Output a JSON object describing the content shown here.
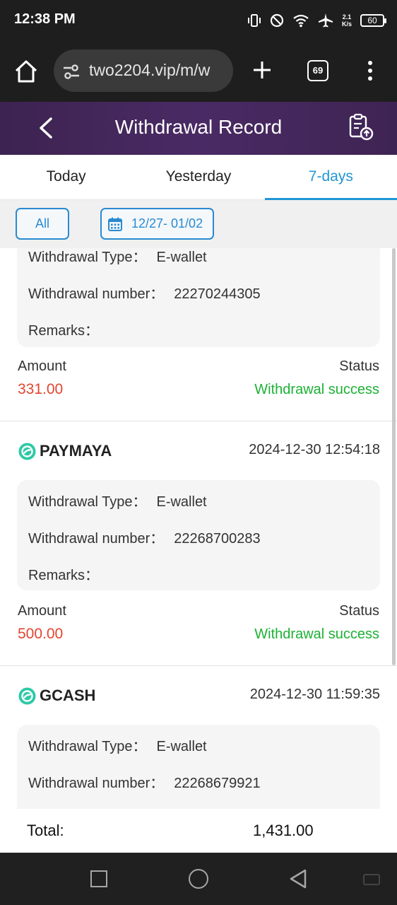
{
  "status_bar": {
    "time": "12:38 PM",
    "net_speed_top": "2.1",
    "net_speed_bottom": "K/s",
    "battery": "60",
    "icons": [
      "vibrate-icon",
      "do-not-disturb-icon",
      "wifi-icon",
      "airplane-icon",
      "battery-icon"
    ]
  },
  "browser": {
    "url": "two2204.vip/m/w",
    "tab_count": "69",
    "icons": [
      "home-icon",
      "site-settings-icon",
      "plus-icon",
      "tabs-icon",
      "more-menu-icon"
    ]
  },
  "header": {
    "title": "Withdrawal Record",
    "icons": [
      "back-arrow-icon",
      "record-upload-icon"
    ]
  },
  "tabs": [
    {
      "label": "Today",
      "active": false
    },
    {
      "label": "Yesterday",
      "active": false
    },
    {
      "label": "7-days",
      "active": true
    }
  ],
  "filters": {
    "all_label": "All",
    "date_range": "12/27- 01/02",
    "calendar_icon": "calendar-icon"
  },
  "labels": {
    "type": "Withdrawal Type：",
    "number": "Withdrawal number：",
    "remarks": "Remarks：",
    "amount": "Amount",
    "status": "Status"
  },
  "records": [
    {
      "method": "",
      "datetime": "",
      "type": "E-wallet",
      "number": "22270244305",
      "remarks": "",
      "amount": "331.00",
      "status": "Withdrawal success"
    },
    {
      "method": "PAYMAYA",
      "datetime": "2024-12-30 12:54:18",
      "type": "E-wallet",
      "number": "22268700283",
      "remarks": "",
      "amount": "500.00",
      "status": "Withdrawal success"
    },
    {
      "method": "GCASH",
      "datetime": "2024-12-30 11:59:35",
      "type": "E-wallet",
      "number": "22268679921",
      "remarks": "",
      "amount": "",
      "status": ""
    }
  ],
  "total": {
    "label": "Total:",
    "value": "1,431.00"
  },
  "colors": {
    "accent_blue": "#2196d6",
    "amount_red": "#e2452f",
    "success_green": "#1cb135",
    "header_purple": "#4a2a64",
    "pay_icon_teal": "#2ec9a7"
  }
}
